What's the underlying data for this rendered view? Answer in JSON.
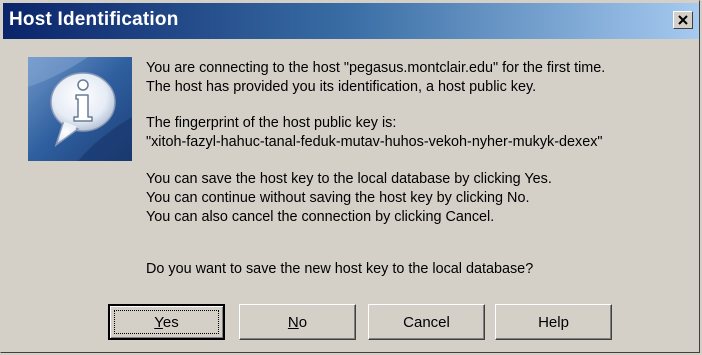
{
  "window": {
    "title": "Host Identification",
    "close_symbol": "×"
  },
  "icon": {
    "name": "info-speech-bubble-icon"
  },
  "message": {
    "lines": [
      "You are connecting to the host \"pegasus.montclair.edu\" for the first time.",
      "The host has provided you its identification, a host public key.",
      "The fingerprint of the host public key is:",
      "\"xitoh-fazyl-hahuc-tanal-feduk-mutav-huhos-vekoh-nyher-mukyk-dexex\"",
      "You can save the host key to the local database by clicking Yes.",
      "You can continue without saving the host key by clicking No.",
      "You can also cancel the connection by clicking Cancel."
    ],
    "question": "Do you want to save the new host key to the local database?"
  },
  "buttons": {
    "yes": {
      "mnemonic": "Y",
      "rest": "es"
    },
    "no": {
      "mnemonic": "N",
      "rest": "o"
    },
    "cancel": "Cancel",
    "help": "Help"
  },
  "colors": {
    "title_gradient_start": "#0a246a",
    "title_gradient_end": "#a6caf0",
    "face": "#d4d0c8",
    "icon_blue": "#3a6ea5"
  }
}
